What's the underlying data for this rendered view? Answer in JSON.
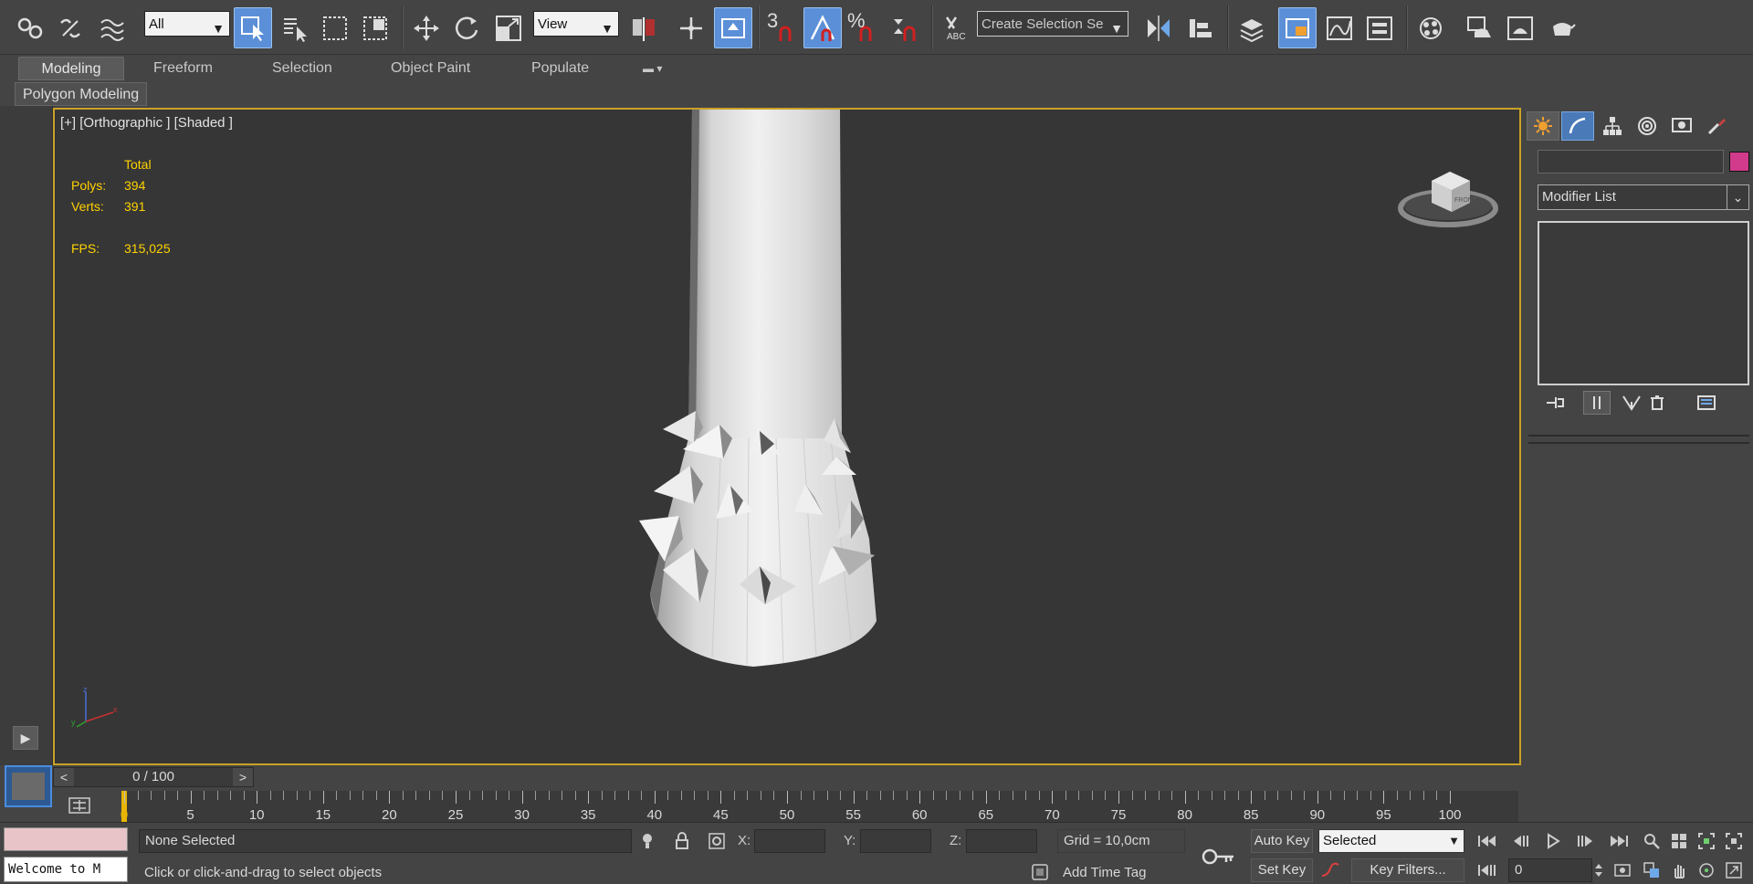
{
  "toolbar": {
    "selection_filter": "All",
    "ref_coord": "View",
    "snap_value": "3",
    "named_selection_placeholder": "Create Selection Se"
  },
  "ribbon": {
    "tabs": [
      "Modeling",
      "Freeform",
      "Selection",
      "Object Paint",
      "Populate"
    ],
    "active_panel": "Polygon Modeling"
  },
  "viewport": {
    "label": "[+] [Orthographic ] [Shaded ]",
    "stats": {
      "header": "Total",
      "polys_label": "Polys:",
      "polys": "394",
      "verts_label": "Verts:",
      "verts": "391",
      "fps_label": "FPS:",
      "fps": "315,025"
    },
    "viewcube_label": "FRONT",
    "axis_labels": {
      "x": "x",
      "y": "y",
      "z": "z"
    }
  },
  "command_panel": {
    "modifier_list": "Modifier List",
    "object_color": "#d23a8c"
  },
  "timeline": {
    "position": "0 / 100",
    "ticks": [
      "5",
      "10",
      "15",
      "20",
      "25",
      "30",
      "35",
      "40",
      "45",
      "50",
      "55",
      "60",
      "65",
      "70",
      "75",
      "80",
      "85",
      "90",
      "95",
      "100"
    ],
    "start_marker": "0"
  },
  "status": {
    "welcome": "Welcome to M",
    "selection": "None Selected",
    "prompt": "Click or click-and-drag to select objects",
    "x_label": "X:",
    "y_label": "Y:",
    "z_label": "Z:",
    "grid": "Grid = 10,0cm",
    "add_time_tag": "Add Time Tag",
    "auto_key": "Auto Key",
    "set_key": "Set Key",
    "key_mode": "Selected",
    "key_filters": "Key Filters...",
    "frame": "0"
  },
  "colors": {
    "viewport_border": "#c9a227",
    "stats_text": "#ffd200",
    "active_button": "#5b8fd8"
  }
}
